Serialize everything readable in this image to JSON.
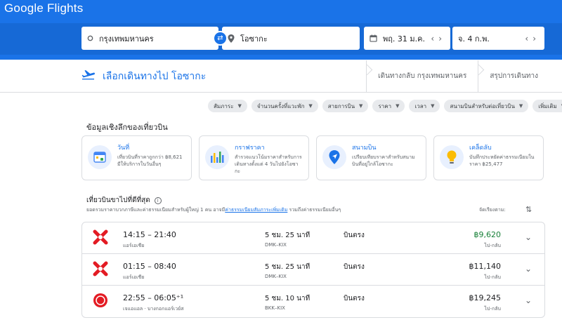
{
  "app": {
    "logo": "Google Flights"
  },
  "search": {
    "from": "กรุงเทพมหานคร",
    "to": "โอซากะ",
    "depart_date": "พฤ. 31 ม.ค.",
    "return_date": "จ. 4 ก.พ."
  },
  "steps": {
    "current": "เลือกเดินทางไป โอซากะ",
    "return": "เดินทางกลับ กรุงเทพมหานคร",
    "summary": "สรุปการเดินทาง"
  },
  "filters": [
    "สัมภาระ",
    "จำนวนครั้งที่แวะพัก",
    "สายการบิน",
    "ราคา",
    "เวลา",
    "สนามบินสำหรับต่อเที่ยวบิน",
    "เพิ่มเติม"
  ],
  "insights": {
    "title": "ข้อมูลเชิงลึกของเที่ยวบิน",
    "cards": [
      {
        "title": "วันที่",
        "desc": "เที่ยวบินที่ราคาถูกกว่า ฿8,621 มีให้บริการในวันอื่นๆ"
      },
      {
        "title": "กราฟราคา",
        "desc": "สำรวจแนวโน้มราคาสำหรับการเดินทางตั้งแต่ 4 วันไปยังโอซากะ"
      },
      {
        "title": "สนามบิน",
        "desc": "เปรียบเทียบราคาสำหรับสนามบินที่อยู่ใกล้โอซากะ"
      },
      {
        "title": "เคล็ดลับ",
        "desc": "บันทึกประหยัดค่าธรรมเนียมในราคา ฿25,477"
      }
    ]
  },
  "results": {
    "title": "เที่ยวบินขาไปที่ดีที่สุด",
    "subtitle_pre": "ยอดรวมราคาบวกภาษีและค่าธรรมเนียมสำหรับผู้ใหญ่ 1 คน อาจมี",
    "subtitle_link": "ค่าธรรมเนียมสัมภาระเพิ่มเติม",
    "subtitle_post": " รวมถึงค่าธรรมเนียมอื่นๆ",
    "sort_label": "จัดเรียงตาม:",
    "flights": [
      {
        "times": "14:15 – 21:40",
        "airline": "แอร์เอเชีย",
        "duration": "5 ชม. 25 นาที",
        "route": "DMK–KIX",
        "stops": "บินตรง",
        "price": "฿9,620",
        "trip": "ไป-กลับ",
        "good": true
      },
      {
        "times": "01:15 – 08:40",
        "airline": "แอร์เอเชีย",
        "duration": "5 ชม. 25 นาที",
        "route": "DMK–KIX",
        "stops": "บินตรง",
        "price": "฿11,140",
        "trip": "ไป-กลับ",
        "good": false
      },
      {
        "times": "22:55 – 06:05⁺¹",
        "airline": "เจแอแอล · บางกอกแอร์เวย์ส",
        "duration": "5 ชม. 10 นาที",
        "route": "BKK–KIX",
        "stops": "บินตรง",
        "price": "฿19,245",
        "trip": "ไป-กลับ",
        "good": false
      }
    ]
  }
}
